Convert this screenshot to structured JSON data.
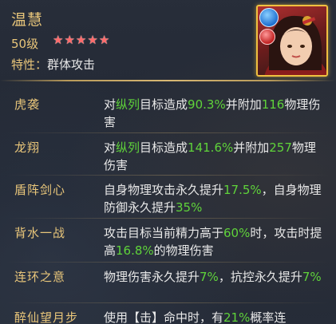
{
  "hero": {
    "name": "温慧",
    "level": "50级",
    "stars": 5,
    "trait_key": "特性：",
    "trait_value": "群体攻击"
  },
  "skills": [
    {
      "name": "虎袭",
      "parts": [
        {
          "t": "对"
        },
        {
          "t": "纵列",
          "g": true
        },
        {
          "t": "目标造成"
        },
        {
          "t": "90.3%",
          "g": true
        },
        {
          "t": "并附加"
        },
        {
          "t": "116",
          "g": true
        },
        {
          "t": "物理伤害"
        }
      ]
    },
    {
      "name": "龙翔",
      "parts": [
        {
          "t": "对"
        },
        {
          "t": "纵列",
          "g": true
        },
        {
          "t": "目标造成"
        },
        {
          "t": "141.6%",
          "g": true
        },
        {
          "t": "并附加"
        },
        {
          "t": "257",
          "g": true
        },
        {
          "t": "物理伤害"
        }
      ]
    },
    {
      "name": "盾阵剑心",
      "parts": [
        {
          "t": "自身物理攻击永久提升"
        },
        {
          "t": "17.5%",
          "g": true
        },
        {
          "t": "，自身物理防御永久提升"
        },
        {
          "t": "35%",
          "g": true
        }
      ]
    },
    {
      "name": "背水一战",
      "parts": [
        {
          "t": "攻击目标当前精力高于"
        },
        {
          "t": "60%",
          "g": true
        },
        {
          "t": "时，攻击时提高"
        },
        {
          "t": "16.8%",
          "g": true
        },
        {
          "t": "的物理伤害"
        }
      ]
    },
    {
      "name": "连环之意",
      "parts": [
        {
          "t": "物理伤害永久提升"
        },
        {
          "t": "7%",
          "g": true
        },
        {
          "t": "，抗控永久提升"
        },
        {
          "t": "7%",
          "g": true
        }
      ]
    },
    {
      "name": "醉仙望月步",
      "parts": [
        {
          "t": "使用【击】命中时，有"
        },
        {
          "t": "21%",
          "g": true
        },
        {
          "t": "概率连"
        }
      ]
    }
  ],
  "colors": {
    "gold": "#e9c67a",
    "green": "#5fd33a",
    "text": "#e8e8e8",
    "star": "#ff6b6b"
  }
}
